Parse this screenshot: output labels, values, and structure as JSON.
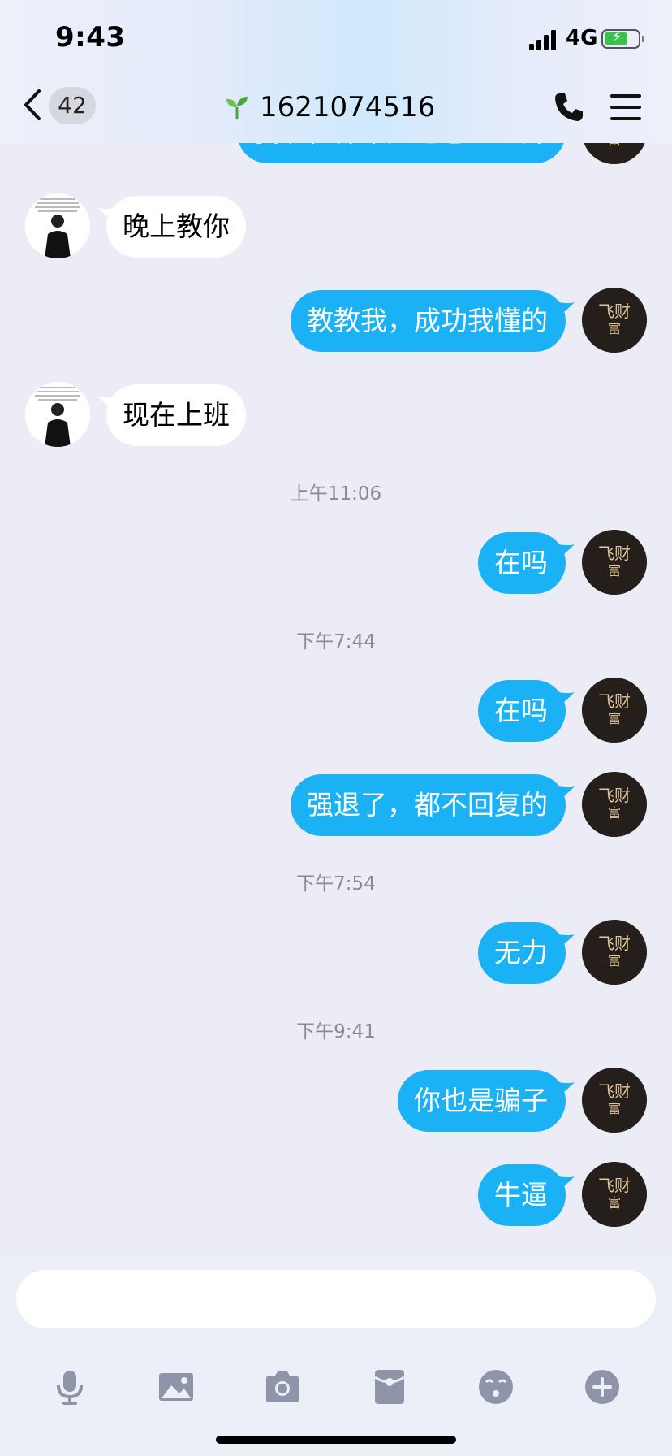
{
  "status_bar": {
    "time": "9:43",
    "network": "4G"
  },
  "header": {
    "unread_count": "42",
    "title": "1621074516"
  },
  "messages": [
    {
      "type": "right",
      "text": "我现在都不知道怎么去弄"
    },
    {
      "type": "left",
      "text": "晚上教你"
    },
    {
      "type": "right",
      "text": "教教我，成功我懂的"
    },
    {
      "type": "left",
      "text": "现在上班"
    },
    {
      "type": "time",
      "text": "上午11:06"
    },
    {
      "type": "right",
      "text": "在吗"
    },
    {
      "type": "time",
      "text": "下午7:44"
    },
    {
      "type": "right",
      "text": "在吗"
    },
    {
      "type": "right",
      "text": "强退了，都不回复的"
    },
    {
      "type": "time",
      "text": "下午7:54"
    },
    {
      "type": "right",
      "text": "无力"
    },
    {
      "type": "time",
      "text": "下午9:41"
    },
    {
      "type": "right",
      "text": "你也是骗子"
    },
    {
      "type": "right",
      "text": "牛逼"
    }
  ],
  "input": {
    "value": ""
  },
  "toolbar": [
    "microphone-icon",
    "image-icon",
    "camera-icon",
    "red-packet-icon",
    "emoji-icon",
    "plus-icon"
  ],
  "colors": {
    "bubble_out": "#1ab2f5",
    "bubble_in": "#ffffff",
    "background": "#ececf6"
  }
}
